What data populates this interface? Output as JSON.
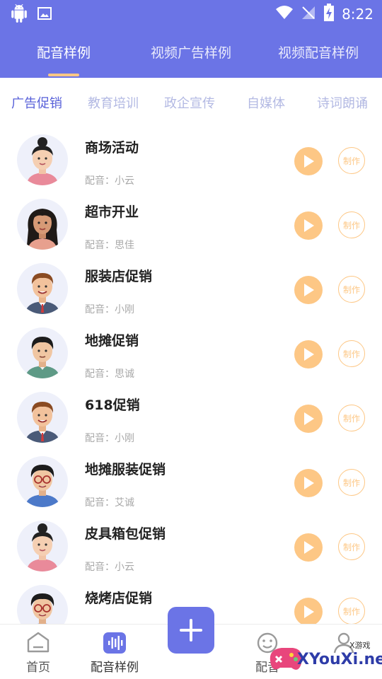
{
  "status_bar": {
    "time": "8:22"
  },
  "top_tabs": [
    {
      "label": "配音样例",
      "active": true
    },
    {
      "label": "视频广告样例",
      "active": false
    },
    {
      "label": "视频配音样例",
      "active": false
    }
  ],
  "category_tabs": [
    {
      "label": "广告促销",
      "active": true
    },
    {
      "label": "教育培训",
      "active": false
    },
    {
      "label": "政企宣传",
      "active": false
    },
    {
      "label": "自媒体",
      "active": false
    },
    {
      "label": "诗词朗诵",
      "active": false
    }
  ],
  "samples": [
    {
      "title": "商场活动",
      "voice": "配音：小云",
      "avatar": "woman-bun-avatar",
      "make_label": "制作"
    },
    {
      "title": "超市开业",
      "voice": "配音：思佳",
      "avatar": "woman-long-hair-avatar",
      "make_label": "制作"
    },
    {
      "title": "服装店促销",
      "voice": "配音：小刚",
      "avatar": "man-suit-avatar",
      "make_label": "制作"
    },
    {
      "title": "地摊促销",
      "voice": "配音：思诚",
      "avatar": "man-green-shirt-avatar",
      "make_label": "制作"
    },
    {
      "title": "618促销",
      "voice": "配音：小刚",
      "avatar": "man-suit-avatar",
      "make_label": "制作"
    },
    {
      "title": "地摊服装促销",
      "voice": "配音：艾诚",
      "avatar": "man-glasses-avatar",
      "make_label": "制作"
    },
    {
      "title": "皮具箱包促销",
      "voice": "配音：小云",
      "avatar": "woman-bun-avatar",
      "make_label": "制作"
    },
    {
      "title": "烧烤店促销",
      "voice": "",
      "avatar": "man-glasses-avatar",
      "make_label": "制作"
    }
  ],
  "bottom_nav": [
    {
      "label": "首页",
      "icon": "home-icon",
      "active": false
    },
    {
      "label": "配音样例",
      "icon": "sound-wave-icon",
      "active": true
    },
    {
      "label": "",
      "icon": "plus-icon",
      "active": false
    },
    {
      "label": "配音",
      "icon": "face-icon",
      "active": false
    },
    {
      "label": "",
      "icon": "user-icon",
      "active": false
    }
  ],
  "watermark": {
    "brand": "XYouXi.net",
    "small": "X游戏"
  },
  "colors": {
    "primary": "#6B74E6",
    "accent": "#FDC785",
    "active_category": "#5861D9",
    "inactive_category": "#B3B9E3"
  }
}
